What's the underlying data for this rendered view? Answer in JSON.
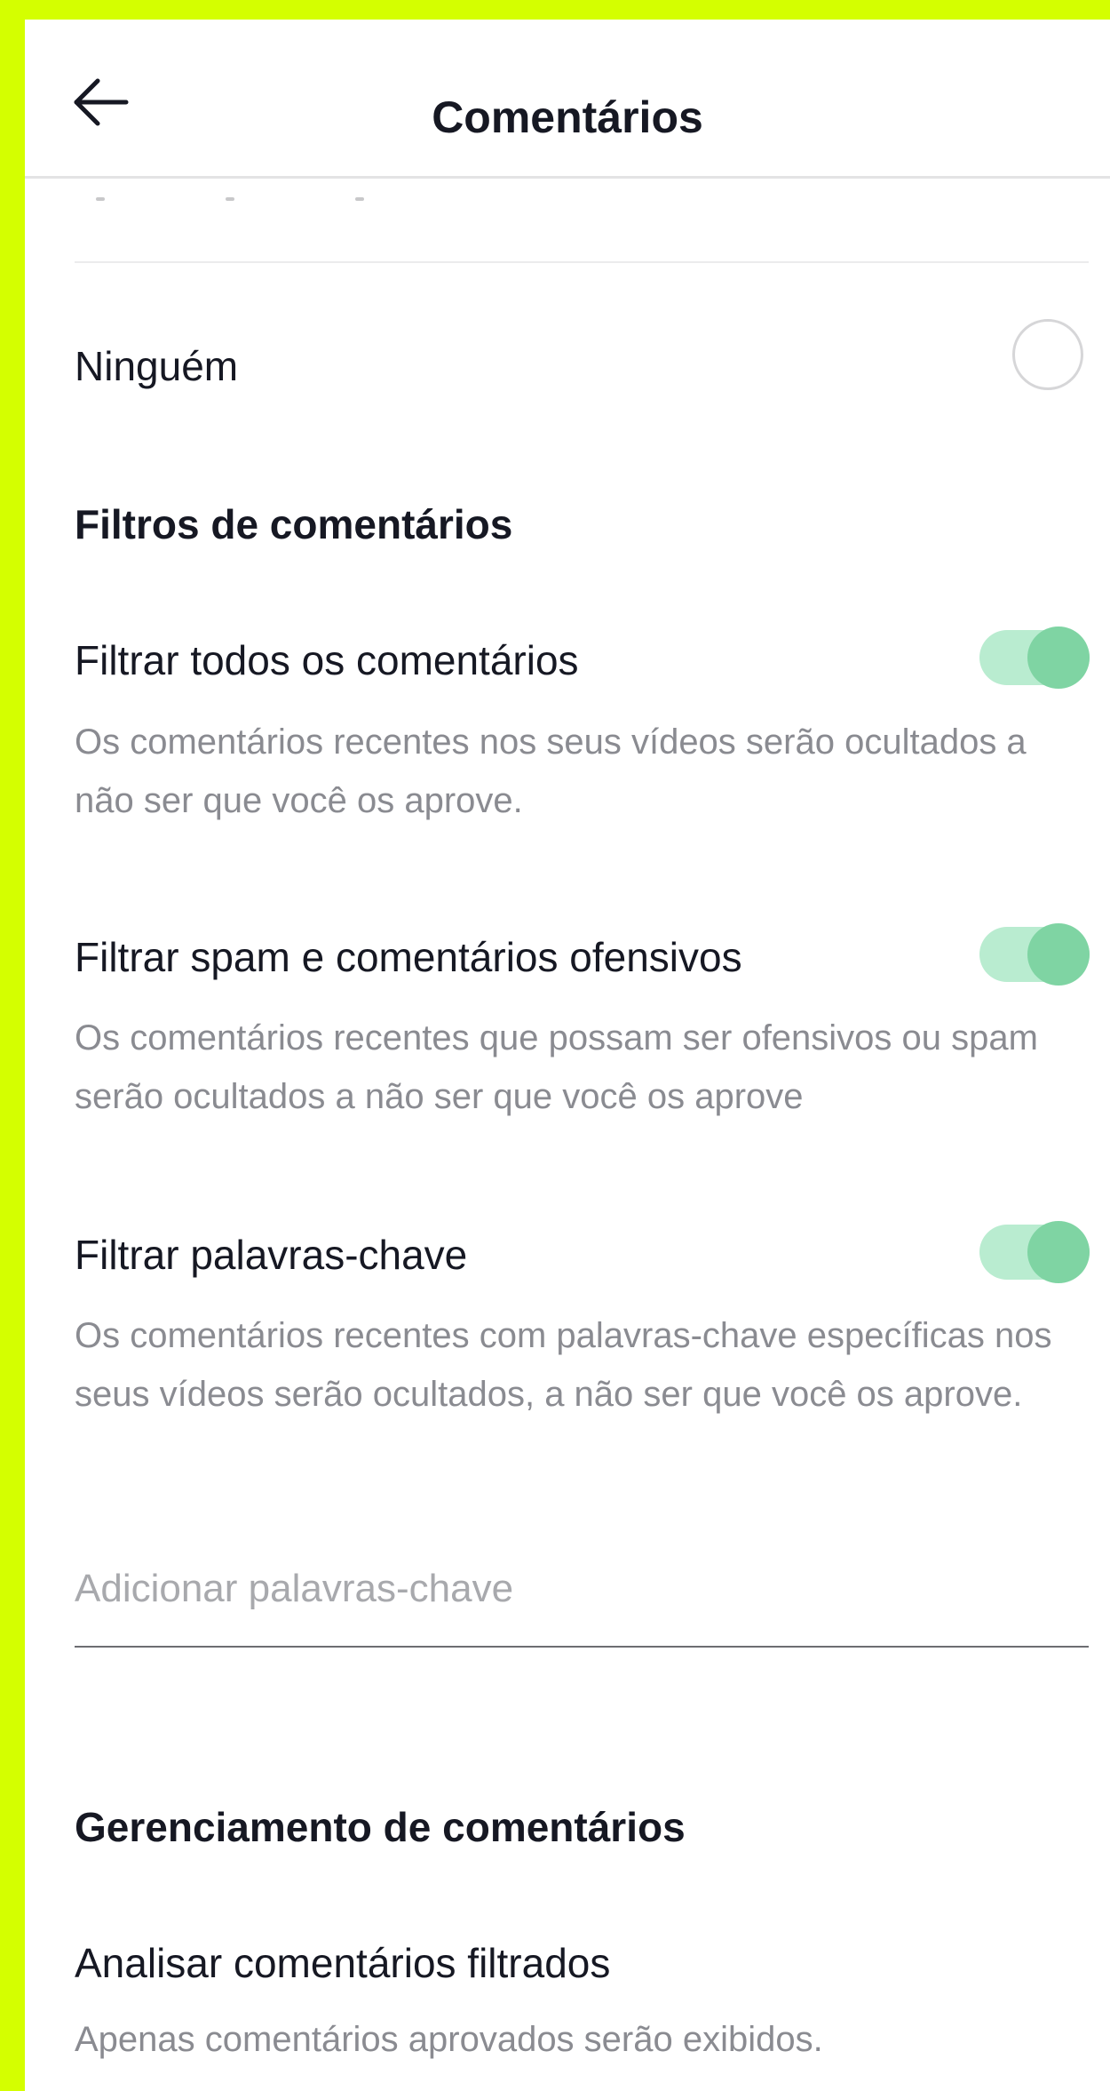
{
  "colors": {
    "frame": "#d4ff00",
    "toggle_track": "#b9ecd0",
    "toggle_knob": "#7fd4a3"
  },
  "header": {
    "back_icon": "arrow-left-icon",
    "title": "Comentários"
  },
  "who_can_comment": {
    "option_nobody": {
      "label": "Ninguém",
      "selected": false
    }
  },
  "filters": {
    "section_title": "Filtros de comentários",
    "items": [
      {
        "label": "Filtrar todos os comentários",
        "description": "Os comentários recentes nos seus vídeos serão ocultados a não ser que você os aprove.",
        "enabled": true
      },
      {
        "label": "Filtrar spam e comentários ofensivos",
        "description": "Os comentários recentes que possam ser ofensivos ou spam serão ocultados a não ser que você os aprove",
        "enabled": true
      },
      {
        "label": "Filtrar palavras-chave",
        "description": "Os comentários recentes com palavras-chave específicas nos seus vídeos serão ocultados, a não ser que você os aprove.",
        "enabled": true
      }
    ],
    "keyword_input": {
      "placeholder": "Adicionar palavras-chave",
      "value": ""
    }
  },
  "management": {
    "section_title": "Gerenciamento de comentários",
    "review_label": "Analisar comentários filtrados",
    "review_description": "Apenas comentários aprovados serão exibidos."
  }
}
